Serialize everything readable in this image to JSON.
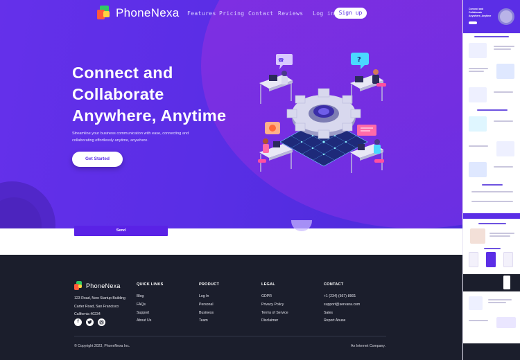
{
  "brand": {
    "name": "PhoneNexa"
  },
  "nav": {
    "links": [
      "Features",
      "Pricing",
      "Contact",
      "Reviews"
    ],
    "login": "Log in",
    "signup": "Sign up"
  },
  "hero": {
    "title_lines": [
      "Connect and",
      "Collaborate",
      "Anywhere, Anytime"
    ],
    "subtitle": "Streamline your business communication with ease, connecting and collaborating effortlessly anytime, anywhere.",
    "cta": "Get Started"
  },
  "form": {
    "send": "Send"
  },
  "footer": {
    "brand": "PhoneNexa",
    "address": [
      "123 Road, New Startup Building",
      "Carter Road, San Francisco",
      "California 40234"
    ],
    "social": [
      "facebook",
      "twitter",
      "instagram"
    ],
    "columns": [
      {
        "title": "QUICK LINKS",
        "items": [
          "Blog",
          "FAQs",
          "Support",
          "About Us"
        ]
      },
      {
        "title": "PRODUCT",
        "items": [
          "Log In",
          "Personal",
          "Business",
          "Team"
        ]
      },
      {
        "title": "LEGAL",
        "items": [
          "GDPR",
          "Privacy Policy",
          "Terms of Service",
          "Disclaimer"
        ]
      },
      {
        "title": "CONTACT",
        "items": [
          "+1 (234) (567)-8901",
          "support@servana.com",
          "Sales",
          "Report Abuse"
        ]
      }
    ],
    "copyright": "© Copyright 2023, PhoneNexa Inc.",
    "tagline": "An Internet Company."
  },
  "thumbnail": {
    "hero_title": "Connect and Collaborate Anywhere, Anytime"
  },
  "colors": {
    "primary": "#5b2ee6",
    "footer_bg": "#1b1e2c",
    "accent_green": "#2fc865",
    "accent_orange": "#ff5a3a"
  }
}
